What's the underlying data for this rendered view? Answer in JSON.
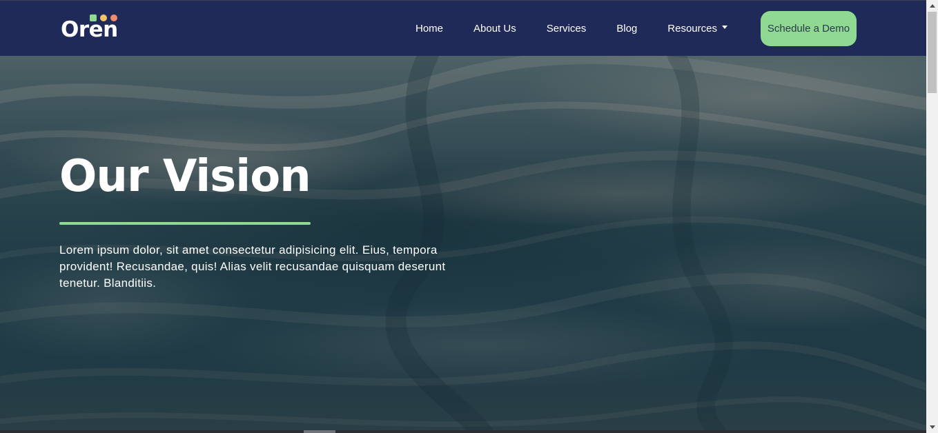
{
  "brand": {
    "name": "Oren",
    "dot_colors": [
      "#8fd992",
      "#f5c06a",
      "#f08a6e"
    ]
  },
  "nav": {
    "items": [
      {
        "label": "Home"
      },
      {
        "label": "About Us"
      },
      {
        "label": "Services"
      },
      {
        "label": "Blog"
      },
      {
        "label": "Resources"
      }
    ],
    "cta_label": "Schedule a Demo"
  },
  "hero": {
    "title": "Our Vision",
    "body": "Lorem ipsum dolor, sit amet consectetur adipisicing elit. Eius, tempora provident! Recusandae, quis! Alias velit recusandae quisquam deserunt tenetur. Blanditiis."
  },
  "colors": {
    "navbar_bg": "#202a58",
    "accent_green": "#8fd992",
    "text_white": "#ffffff"
  }
}
